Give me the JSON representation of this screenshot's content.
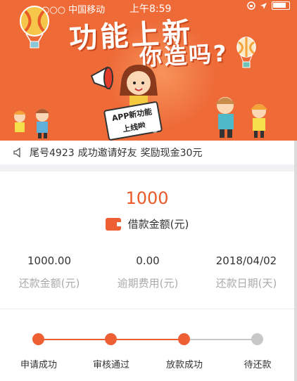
{
  "status_bar": {
    "carrier": "•○○○○ 中国移动",
    "time": "上午8:59"
  },
  "banner": {
    "headline_line1": "功能上新",
    "headline_line2": "你造吗?",
    "sign_text_line1": "APP新功能",
    "sign_text_line2": "上线啦"
  },
  "notice": {
    "tail_number": "尾号4923",
    "event": "成功邀请好友",
    "reward": "奖励现金30元"
  },
  "loan": {
    "amount": "1000",
    "amount_label": "借款金额(元)"
  },
  "stats": [
    {
      "value": "1000.00",
      "label": "还款金额(元)"
    },
    {
      "value": "0.00",
      "label": "逾期费用(元)"
    },
    {
      "value": "2018/04/02",
      "label": "还款日期(天)"
    }
  ],
  "progress": {
    "steps": [
      {
        "label": "申请成功",
        "done": true
      },
      {
        "label": "审核通过",
        "done": true
      },
      {
        "label": "放款成功",
        "done": true
      },
      {
        "label": "待还款",
        "done": false
      }
    ]
  },
  "colors": {
    "accent": "#ee6033",
    "banner_bg": "#ee6b38",
    "pending": "#c8c8c8"
  }
}
